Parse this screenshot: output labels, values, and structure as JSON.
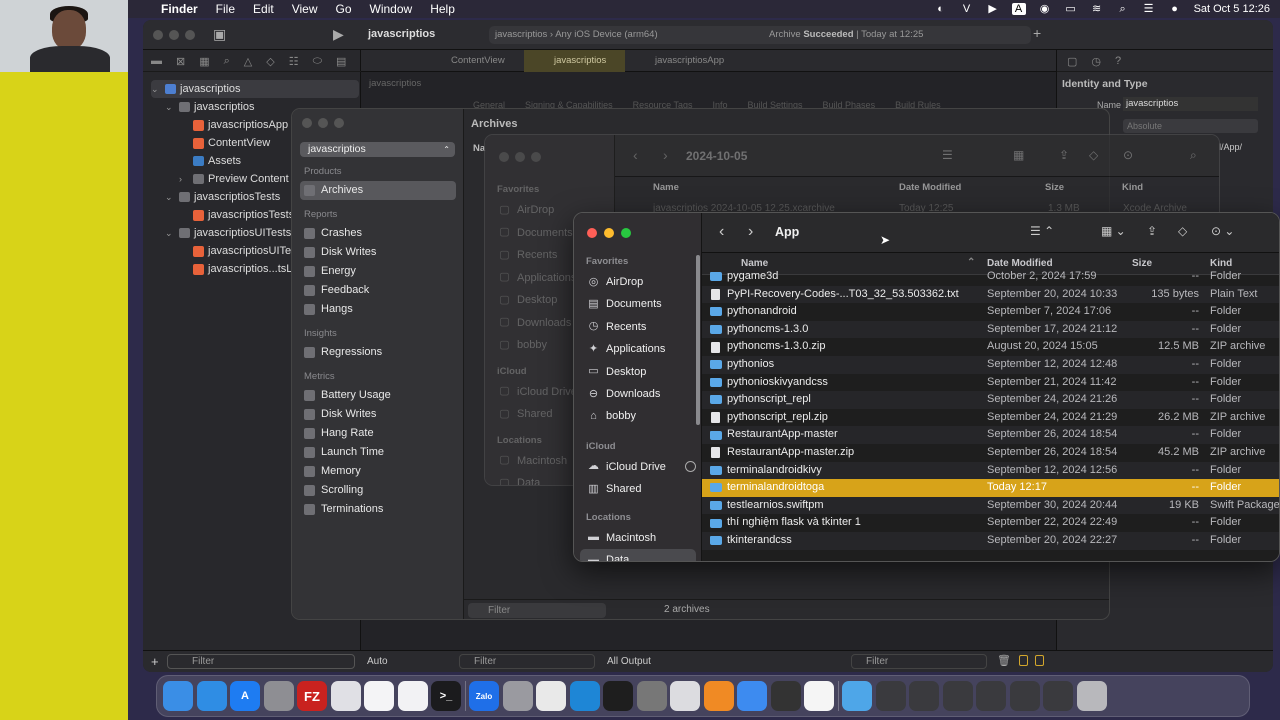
{
  "menubar": {
    "app_name": "Finder",
    "menus": [
      "File",
      "Edit",
      "View",
      "Go",
      "Window",
      "Help"
    ],
    "datetime": "Sat Oct 5  12:26",
    "status_icons": [
      "stage-manager-icon",
      "v-icon",
      "play-icon",
      "a-input-icon",
      "record-icon",
      "battery-icon",
      "wifi-icon",
      "search-icon",
      "control-center-icon",
      "siri-icon"
    ]
  },
  "xcode": {
    "project": "javascriptios",
    "scheme": "javascriptios",
    "device": "Any iOS Device (arm64)",
    "status": "Archive",
    "status_bold": "Succeeded",
    "status_time": "Today at 12:25",
    "tabs": [
      "ContentView",
      "javascriptios",
      "javascriptiosApp"
    ],
    "breadcrumb": "javascriptios",
    "editor_tabs": [
      "General",
      "Signing & Capabilities",
      "Resource Tags",
      "Info",
      "Build Settings",
      "Build Phases",
      "Build Rules"
    ],
    "navigator": [
      {
        "label": "javascriptios",
        "level": 0,
        "type": "project",
        "open": true
      },
      {
        "label": "javascriptios",
        "level": 1,
        "type": "folder",
        "open": true
      },
      {
        "label": "javascriptiosApp",
        "level": 2,
        "type": "swift"
      },
      {
        "label": "ContentView",
        "level": 2,
        "type": "swift"
      },
      {
        "label": "Assets",
        "level": 2,
        "type": "assets"
      },
      {
        "label": "Preview Content",
        "level": 2,
        "type": "folder",
        "open": false
      },
      {
        "label": "javascriptiosTests",
        "level": 1,
        "type": "folder",
        "open": true
      },
      {
        "label": "javascriptiosTests",
        "level": 2,
        "type": "swift"
      },
      {
        "label": "javascriptiosUITests",
        "level": 1,
        "type": "folder",
        "open": true
      },
      {
        "label": "javascriptiosUITests",
        "level": 2,
        "type": "swift"
      },
      {
        "label": "javascriptios...tsLaunchTests",
        "level": 2,
        "type": "swift"
      }
    ],
    "inspector": {
      "title": "Identity and Type",
      "name_label": "Name",
      "name_value": "javascriptios",
      "location_label": "Location",
      "location_value": "Absolute",
      "path_fragment": "l/App/"
    },
    "bottom": {
      "filter_placeholder": "Filter",
      "auto": "Auto",
      "filter2": "Filter",
      "output": "All Output",
      "filter3": "Filter"
    }
  },
  "organizer": {
    "title": "Archives",
    "scheme_select": "javascriptios",
    "sections": [
      {
        "title": "Products",
        "items": [
          "Archives"
        ]
      },
      {
        "title": "Reports",
        "items": [
          "Crashes",
          "Disk Writes",
          "Energy",
          "Feedback",
          "Hangs"
        ]
      },
      {
        "title": "Insights",
        "items": [
          "Regressions"
        ]
      },
      {
        "title": "Metrics",
        "items": [
          "Battery Usage",
          "Disk Writes",
          "Hang Rate",
          "Launch Time",
          "Memory",
          "Scrolling",
          "Terminations"
        ]
      }
    ],
    "filter_placeholder": "Filter",
    "count": "2 archives",
    "col_name": "Na"
  },
  "finder_back": {
    "title": "2024-10-05",
    "favorites_label": "Favorites",
    "favorites": [
      "AirDrop",
      "Documents",
      "Recents",
      "Applications",
      "Desktop",
      "Downloads",
      "bobby"
    ],
    "icloud_label": "iCloud",
    "icloud": [
      "iCloud Drive",
      "Shared"
    ],
    "locations_label": "Locations",
    "locations": [
      "Macintosh",
      "Data"
    ],
    "columns": [
      "Name",
      "Date Modified",
      "Size",
      "Kind"
    ],
    "row": {
      "name": "javascriptios 2024-10-05 12.25.xcarchive",
      "date": "Today 12:25",
      "size": "1.3 MB",
      "kind": "Xcode Archive"
    }
  },
  "finder": {
    "title": "App",
    "favorites_label": "Favorites",
    "favorites": [
      {
        "label": "AirDrop",
        "icon": "airdrop-icon"
      },
      {
        "label": "Documents",
        "icon": "document-icon"
      },
      {
        "label": "Recents",
        "icon": "clock-icon"
      },
      {
        "label": "Applications",
        "icon": "applications-icon"
      },
      {
        "label": "Desktop",
        "icon": "desktop-icon"
      },
      {
        "label": "Downloads",
        "icon": "download-icon"
      },
      {
        "label": "bobby",
        "icon": "home-icon"
      }
    ],
    "icloud_label": "iCloud",
    "icloud": [
      {
        "label": "iCloud Drive",
        "icon": "cloud-icon"
      },
      {
        "label": "Shared",
        "icon": "shared-folder-icon"
      }
    ],
    "locations_label": "Locations",
    "locations": [
      {
        "label": "Macintosh",
        "icon": "disk-icon"
      },
      {
        "label": "Data",
        "icon": "disk-icon"
      }
    ],
    "columns": {
      "name": "Name",
      "date": "Date Modified",
      "size": "Size",
      "kind": "Kind"
    },
    "files": [
      {
        "name": "pygame3d",
        "date": "October 2, 2024 17:59",
        "size": "--",
        "kind": "Folder",
        "type": "folder"
      },
      {
        "name": "PyPI-Recovery-Codes-...T03_32_53.503362.txt",
        "date": "September 20, 2024 10:33",
        "size": "135 bytes",
        "kind": "Plain Text",
        "type": "doc"
      },
      {
        "name": "pythonandroid",
        "date": "September 7, 2024 17:06",
        "size": "--",
        "kind": "Folder",
        "type": "folder"
      },
      {
        "name": "pythoncms-1.3.0",
        "date": "September 17, 2024 21:12",
        "size": "--",
        "kind": "Folder",
        "type": "folder"
      },
      {
        "name": "pythoncms-1.3.0.zip",
        "date": "August 20, 2024 15:05",
        "size": "12.5 MB",
        "kind": "ZIP archive",
        "type": "doc"
      },
      {
        "name": "pythonios",
        "date": "September 12, 2024 12:48",
        "size": "--",
        "kind": "Folder",
        "type": "folder"
      },
      {
        "name": "pythonioskivyandcss",
        "date": "September 21, 2024 11:42",
        "size": "--",
        "kind": "Folder",
        "type": "folder"
      },
      {
        "name": "pythonscript_repl",
        "date": "September 24, 2024 21:26",
        "size": "--",
        "kind": "Folder",
        "type": "folder"
      },
      {
        "name": "pythonscript_repl.zip",
        "date": "September 24, 2024 21:29",
        "size": "26.2 MB",
        "kind": "ZIP archive",
        "type": "doc"
      },
      {
        "name": "RestaurantApp-master",
        "date": "September 26, 2024 18:54",
        "size": "--",
        "kind": "Folder",
        "type": "folder"
      },
      {
        "name": "RestaurantApp-master.zip",
        "date": "September 26, 2024 18:54",
        "size": "45.2 MB",
        "kind": "ZIP archive",
        "type": "doc"
      },
      {
        "name": "terminalandroidkivy",
        "date": "September 12, 2024 12:56",
        "size": "--",
        "kind": "Folder",
        "type": "folder"
      },
      {
        "name": "terminalandroidtoga",
        "date": "Today 12:17",
        "size": "--",
        "kind": "Folder",
        "type": "folder",
        "selected": true
      },
      {
        "name": "testlearnios.swiftpm",
        "date": "September 30, 2024 20:44",
        "size": "19 KB",
        "kind": "Swift Package",
        "type": "folder"
      },
      {
        "name": "thí nghiệm flask và tkinter 1",
        "date": "September 22, 2024 22:49",
        "size": "--",
        "kind": "Folder",
        "type": "folder"
      },
      {
        "name": "tkinterandcss",
        "date": "September 20, 2024 22:27",
        "size": "--",
        "kind": "Folder",
        "type": "folder"
      }
    ]
  },
  "dock": {
    "apps": [
      {
        "name": "finder-icon",
        "color": "#3a8ee6",
        "label": ""
      },
      {
        "name": "safari-icon",
        "color": "#2f8de4",
        "label": ""
      },
      {
        "name": "app-store-icon",
        "color": "#1e7cf2",
        "label": "A"
      },
      {
        "name": "system-settings-icon",
        "color": "#8e8e93",
        "label": ""
      },
      {
        "name": "filezilla-icon",
        "color": "#c9221f",
        "label": "FZ"
      },
      {
        "name": "launchpad-icon",
        "color": "#e0e0e5",
        "label": ""
      },
      {
        "name": "freeform-icon",
        "color": "#f4f4f6",
        "label": ""
      },
      {
        "name": "pages-icon",
        "color": "#f2f2f4",
        "label": ""
      },
      {
        "name": "terminal-icon",
        "color": "#1b1b1d",
        "label": ">_"
      },
      {
        "name": "zalo-icon",
        "color": "#1f6fe8",
        "label": "Zalo"
      },
      {
        "name": "settings-gear-icon",
        "color": "#9a9aa0",
        "label": ""
      },
      {
        "name": "chrome-icon",
        "color": "#e9e9e9",
        "label": ""
      },
      {
        "name": "vscode-icon",
        "color": "#1e86d6",
        "label": ""
      },
      {
        "name": "activity-monitor-icon",
        "color": "#1e1e1e",
        "label": ""
      },
      {
        "name": "python-launcher-icon",
        "color": "#777",
        "label": ""
      },
      {
        "name": "preview-icon",
        "color": "#dcdce0",
        "label": ""
      },
      {
        "name": "books-icon",
        "color": "#f08a24",
        "label": ""
      },
      {
        "name": "xcode-icon",
        "color": "#3d8bf0",
        "label": ""
      },
      {
        "name": "instruments-icon",
        "color": "#333",
        "label": ""
      },
      {
        "name": "textedit-icon",
        "color": "#f5f5f5",
        "label": ""
      },
      {
        "name": "finder-folder-icon",
        "color": "#4ea6e8",
        "label": ""
      },
      {
        "name": "window-thumb-1-icon",
        "color": "#3a3a3e",
        "label": ""
      },
      {
        "name": "window-thumb-2-icon",
        "color": "#3a3a3e",
        "label": ""
      },
      {
        "name": "window-thumb-3-icon",
        "color": "#3a3a3e",
        "label": ""
      },
      {
        "name": "window-thumb-4-icon",
        "color": "#3a3a3e",
        "label": ""
      },
      {
        "name": "window-thumb-5-icon",
        "color": "#3a3a3e",
        "label": ""
      },
      {
        "name": "window-thumb-6-icon",
        "color": "#3a3a3e",
        "label": ""
      },
      {
        "name": "trash-icon",
        "color": "#b8b8bc",
        "label": ""
      }
    ]
  },
  "colors": {
    "selection": "#d7a319",
    "folder": "#5aa8e8",
    "desktop_strip": "#d8d318"
  }
}
